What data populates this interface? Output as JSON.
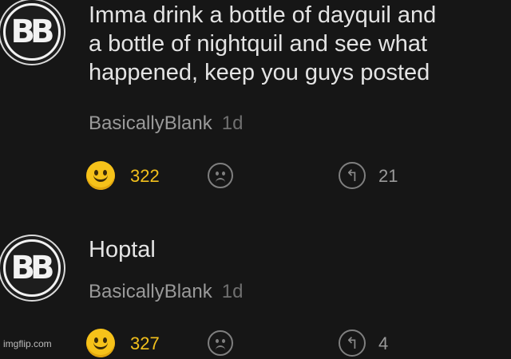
{
  "comments": [
    {
      "avatar_text": "BB",
      "text": "Imma drink a bottle of dayquil and\na bottle of nightquil and see what\nhappened, keep you guys posted",
      "author": "BasicallyBlank",
      "time": "1d",
      "likes": "322",
      "replies": "21"
    },
    {
      "avatar_text": "BB",
      "text": "Hoptal",
      "author": "BasicallyBlank",
      "time": "1d",
      "likes": "327",
      "replies": "4"
    }
  ],
  "colors": {
    "background": "#161616",
    "like": "#f2c01c",
    "muted": "#9a9a9a"
  },
  "icons": {
    "like": "smile-icon",
    "dislike": "frown-icon",
    "reply": "reply-icon"
  },
  "watermark": "imgflip.com"
}
